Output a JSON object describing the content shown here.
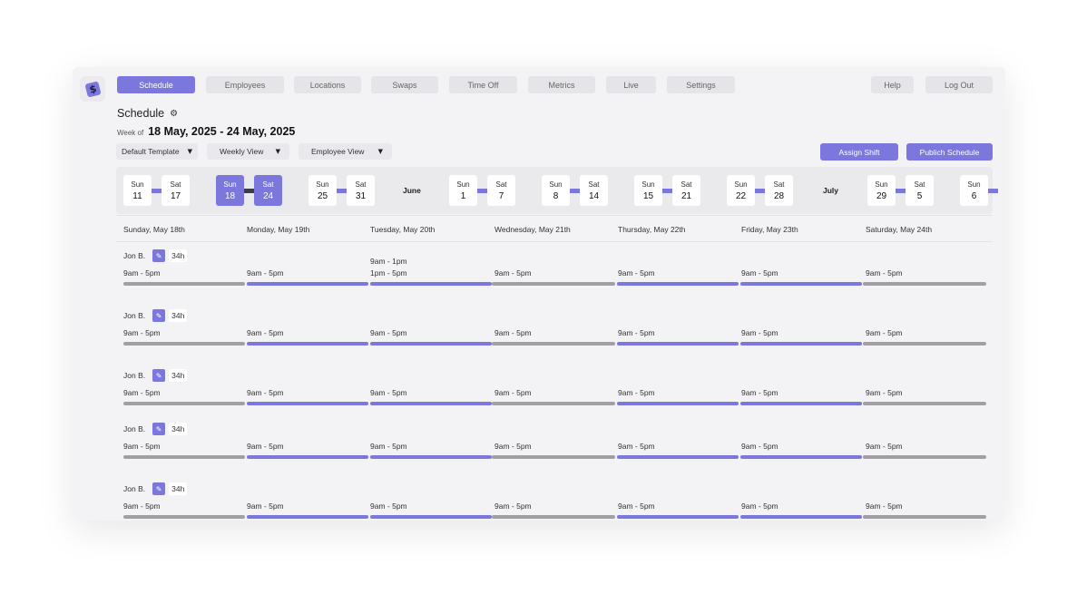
{
  "nav": {
    "schedule": "Schedule",
    "employees": "Employees",
    "locations": "Locations",
    "swaps": "Swaps",
    "time_off": "Time Off",
    "metrics": "Metrics",
    "live": "Live",
    "settings": "Settings",
    "help": "Help",
    "log_out": "Log Out"
  },
  "logo_icon": "logo-icon",
  "page": {
    "title": "Schedule",
    "title_icon": "gear-icon",
    "week_of_label": "Week of",
    "week_range": "18 May, 2025 - 24 May, 2025"
  },
  "toolbar": {
    "template_select": "Default Template",
    "view_select": "Weekly View",
    "group_select": "Employee View",
    "assign_shift": "Assign Shift",
    "publish_schedule": "Publich Schedule"
  },
  "accent_color": "#7b77dd",
  "weeks": [
    {
      "start_day": "Sun",
      "start": "11",
      "end_day": "Sat",
      "end": "17",
      "selected": false
    },
    {
      "start_day": "Sun",
      "start": "18",
      "end_day": "Sat",
      "end": "24",
      "selected": true
    },
    {
      "start_day": "Sun",
      "start": "25",
      "end_day": "Sat",
      "end": "31",
      "selected": false
    },
    {
      "start_day": "Sun",
      "start": "1",
      "end_day": "Sat",
      "end": "7",
      "selected": false
    },
    {
      "start_day": "Sun",
      "start": "8",
      "end_day": "Sat",
      "end": "14",
      "selected": false
    },
    {
      "start_day": "Sun",
      "start": "15",
      "end_day": "Sat",
      "end": "21",
      "selected": false
    },
    {
      "start_day": "Sun",
      "start": "22",
      "end_day": "Sat",
      "end": "28",
      "selected": false
    },
    {
      "start_day": "Sun",
      "start": "29",
      "end_day": "Sat",
      "end": "5",
      "selected": false
    },
    {
      "start_day": "Sun",
      "start": "6",
      "end_day": "",
      "end": "",
      "selected": false
    }
  ],
  "months": [
    "June",
    "July"
  ],
  "days": [
    "Sunday, May 18th",
    "Monday, May 19th",
    "Tuesday, May 20th",
    "Wednesday, May 21th",
    "Thursday, May 22th",
    "Friday, May 23th",
    "Saturday, May 24th"
  ],
  "employees": [
    {
      "name": "Jon B.",
      "hours": "34h",
      "shifts": [
        [
          "9am - 5pm"
        ],
        [
          "9am - 5pm"
        ],
        [
          "9am - 1pm",
          "1pm - 5pm"
        ],
        [
          "9am - 5pm"
        ],
        [
          "9am - 5pm"
        ],
        [
          "9am - 5pm"
        ],
        [
          "9am - 5pm"
        ]
      ]
    },
    {
      "name": "Jon B.",
      "hours": "34h",
      "shifts": [
        [
          "9am - 5pm"
        ],
        [
          "9am - 5pm"
        ],
        [
          "9am - 5pm"
        ],
        [
          "9am - 5pm"
        ],
        [
          "9am - 5pm"
        ],
        [
          "9am - 5pm"
        ],
        [
          "9am - 5pm"
        ]
      ]
    },
    {
      "name": "Jon B.",
      "hours": "34h",
      "shifts": [
        [
          "9am - 5pm"
        ],
        [
          "9am - 5pm"
        ],
        [
          "9am - 5pm"
        ],
        [
          "9am - 5pm"
        ],
        [
          "9am - 5pm"
        ],
        [
          "9am - 5pm"
        ],
        [
          "9am - 5pm"
        ]
      ]
    },
    {
      "name": "Jon B.",
      "hours": "34h",
      "shifts": [
        [
          "9am - 5pm"
        ],
        [
          "9am - 5pm"
        ],
        [
          "9am - 5pm"
        ],
        [
          "9am - 5pm"
        ],
        [
          "9am - 5pm"
        ],
        [
          "9am - 5pm"
        ],
        [
          "9am - 5pm"
        ]
      ]
    },
    {
      "name": "Jon B.",
      "hours": "34h",
      "shifts": [
        [
          "9am - 5pm"
        ],
        [
          "9am - 5pm"
        ],
        [
          "9am - 5pm"
        ],
        [
          "9am - 5pm"
        ],
        [
          "9am - 5pm"
        ],
        [
          "9am - 5pm"
        ],
        [
          "9am - 5pm"
        ]
      ]
    }
  ],
  "day_bar_colors": [
    "gray",
    "purple",
    "purple",
    "gray",
    "purple",
    "purple",
    "gray"
  ]
}
